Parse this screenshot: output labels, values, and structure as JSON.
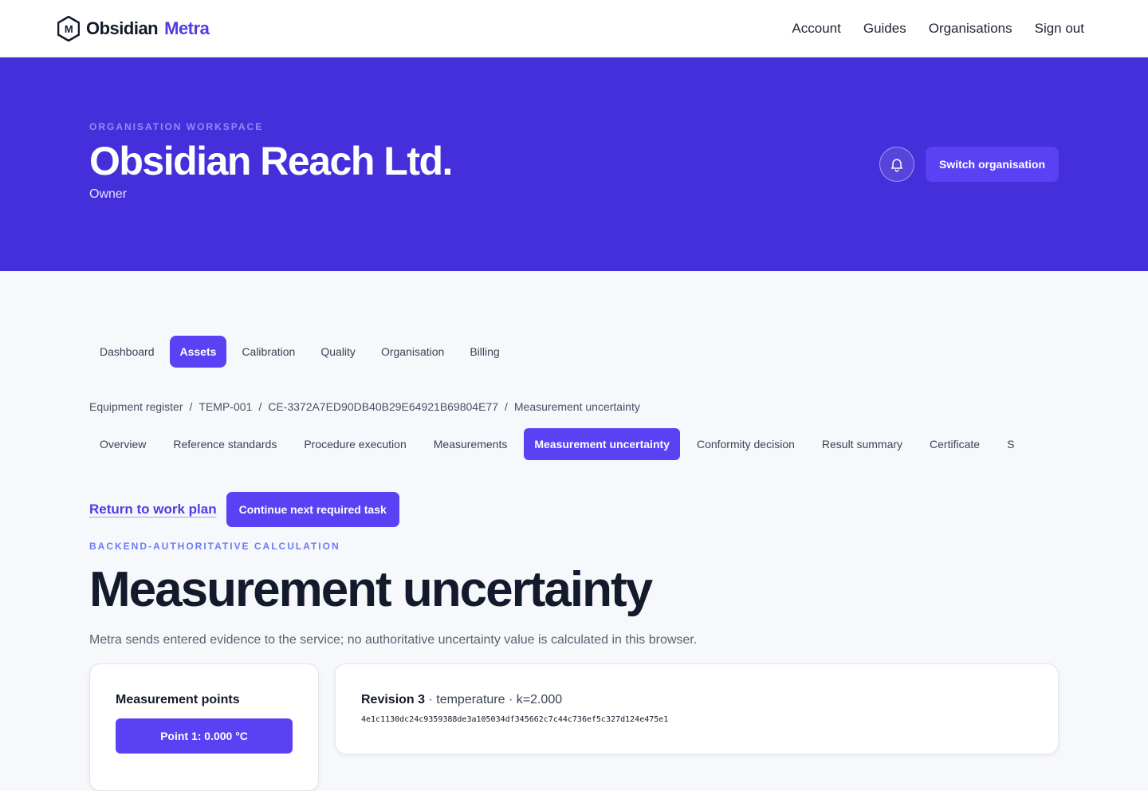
{
  "brand": {
    "name_part1": "Obsidian",
    "name_part2": "Metra",
    "logo_letter": "M"
  },
  "topnav": [
    "Account",
    "Guides",
    "Organisations",
    "Sign out"
  ],
  "hero": {
    "eyebrow": "ORGANISATION WORKSPACE",
    "title": "Obsidian Reach Ltd.",
    "role": "Owner",
    "switch_label": "Switch organisation",
    "bell_icon": "bell-icon",
    "background": "#452fda",
    "accent": "#5a41f4"
  },
  "main_tabs": [
    {
      "label": "Dashboard",
      "active": false
    },
    {
      "label": "Assets",
      "active": true
    },
    {
      "label": "Calibration",
      "active": false
    },
    {
      "label": "Quality",
      "active": false
    },
    {
      "label": "Organisation",
      "active": false
    },
    {
      "label": "Billing",
      "active": false
    }
  ],
  "breadcrumb": [
    "Equipment register",
    "TEMP-001",
    "CE-3372A7ED90DB40B29E64921B69804E77",
    "Measurement uncertainty"
  ],
  "sub_tabs": [
    {
      "label": "Overview",
      "active": false
    },
    {
      "label": "Reference standards",
      "active": false
    },
    {
      "label": "Procedure execution",
      "active": false
    },
    {
      "label": "Measurements",
      "active": false
    },
    {
      "label": "Measurement uncertainty",
      "active": true
    },
    {
      "label": "Conformity decision",
      "active": false
    },
    {
      "label": "Result summary",
      "active": false
    },
    {
      "label": "Certificate",
      "active": false
    },
    {
      "label": "S",
      "active": false
    }
  ],
  "actions": {
    "return_link": "Return to work plan",
    "continue_button": "Continue next required task"
  },
  "section": {
    "eyebrow": "BACKEND-AUTHORITATIVE CALCULATION",
    "title": "Measurement uncertainty",
    "description": "Metra sends entered evidence to the service; no authoritative uncertainty value is calculated in this browser."
  },
  "points_card": {
    "title": "Measurement points",
    "point_button": "Point 1: 0.000 °C"
  },
  "revision_card": {
    "revision": "Revision 3",
    "details": " · temperature · k=2.000",
    "hash": "4e1c1130dc24c9359388de3a105034df345662c7c44c736ef5c327d124e475e1"
  }
}
